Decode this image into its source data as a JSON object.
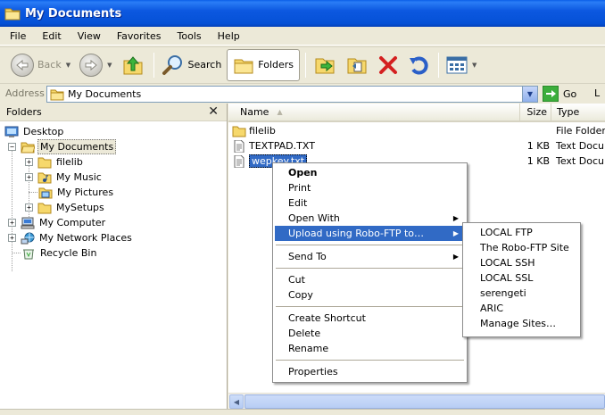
{
  "window": {
    "title": "My Documents"
  },
  "menubar": [
    "File",
    "Edit",
    "View",
    "Favorites",
    "Tools",
    "Help"
  ],
  "toolbar": {
    "back_label": "Back",
    "search_label": "Search",
    "folders_label": "Folders"
  },
  "address": {
    "label": "Address",
    "value": "My Documents",
    "go_label": "Go",
    "trailing_label": "L"
  },
  "folders_pane": {
    "title": "Folders",
    "close_glyph": "✕",
    "items": [
      {
        "label": "Desktop",
        "icon": "desktop-icon",
        "expand": ""
      },
      {
        "label": "My Documents",
        "icon": "open-folder-icon",
        "expand": "−",
        "selected": true
      },
      {
        "label": "filelib",
        "icon": "folder-icon",
        "expand": "+"
      },
      {
        "label": "My Music",
        "icon": "music-folder-icon",
        "expand": "+"
      },
      {
        "label": "My Pictures",
        "icon": "pictures-folder-icon",
        "expand": ""
      },
      {
        "label": "MySetups",
        "icon": "folder-icon",
        "expand": "+"
      },
      {
        "label": "My Computer",
        "icon": "computer-icon",
        "expand": "+"
      },
      {
        "label": "My Network Places",
        "icon": "network-icon",
        "expand": "+"
      },
      {
        "label": "Recycle Bin",
        "icon": "recycle-bin-icon",
        "expand": ""
      }
    ]
  },
  "filelist": {
    "columns": {
      "name": "Name",
      "size": "Size",
      "type": "Type"
    },
    "rows": [
      {
        "name": "filelib",
        "size": "",
        "type": "File Folder",
        "icon": "folder-icon"
      },
      {
        "name": "TEXTPAD.TXT",
        "size": "1 KB",
        "type": "Text Docum",
        "icon": "text-file-icon"
      },
      {
        "name": "wepkey.txt",
        "size": "1 KB",
        "type": "Text Docum",
        "icon": "text-file-icon",
        "selected": true
      }
    ]
  },
  "context_menu": {
    "items": [
      {
        "label": "Open",
        "bold": true
      },
      {
        "label": "Print"
      },
      {
        "label": "Edit"
      },
      {
        "label": "Open With",
        "submenu": true
      },
      {
        "label": "Upload using Robo-FTP to…",
        "submenu": true,
        "highlighted": true
      },
      {
        "label": "Send To",
        "submenu": true
      },
      {
        "label": "Cut"
      },
      {
        "label": "Copy"
      },
      {
        "label": "Create Shortcut"
      },
      {
        "label": "Delete"
      },
      {
        "label": "Rename"
      },
      {
        "label": "Properties"
      }
    ]
  },
  "submenu": {
    "items": [
      "LOCAL FTP",
      "The Robo-FTP Site",
      "LOCAL SSH",
      "LOCAL SSL",
      "serengeti",
      "ARIC",
      "Manage Sites…"
    ]
  },
  "colors": {
    "title_bar": "#0551d6",
    "selection": "#316ac5",
    "chrome": "#ece9d8"
  }
}
